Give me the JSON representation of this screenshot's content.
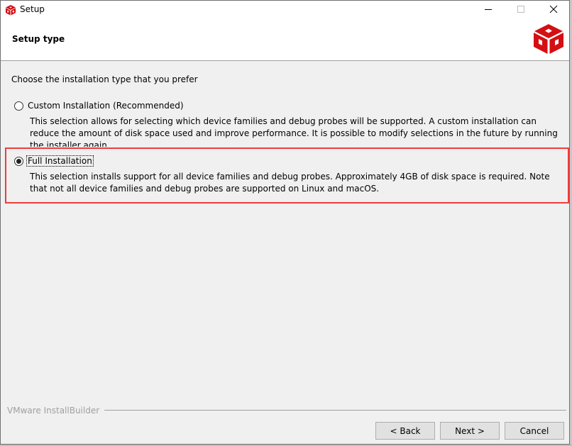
{
  "window": {
    "title": "Setup",
    "app_icon": "red-cube-icon",
    "controls": {
      "minimize": "minimize-icon",
      "maximize": "maximize-icon",
      "close": "close-icon"
    }
  },
  "header": {
    "title": "Setup type",
    "logo": "red-cube-logo"
  },
  "content": {
    "prompt": "Choose the installation type that you prefer",
    "options": [
      {
        "label": "Custom Installation (Recommended)",
        "selected": false,
        "description": "This selection allows for selecting which device families and debug probes will be supported.  A custom installation can reduce the amount of disk space used and improve performance.  It is possible to modify selections in the future by running the installer again."
      },
      {
        "label": "Full Installation",
        "selected": true,
        "description": "This selection installs support for all device families and debug probes.  Approximately 4GB of disk space is required.  Note that not all device families and debug probes are supported on Linux and macOS."
      }
    ]
  },
  "footer": {
    "brand": "VMware InstallBuilder",
    "buttons": {
      "back": "< Back",
      "next": "Next >",
      "cancel": "Cancel"
    }
  },
  "colors": {
    "accent_red": "#d40f14",
    "highlight_border": "#f03c3c",
    "window_bg": "#f0f0f0"
  }
}
